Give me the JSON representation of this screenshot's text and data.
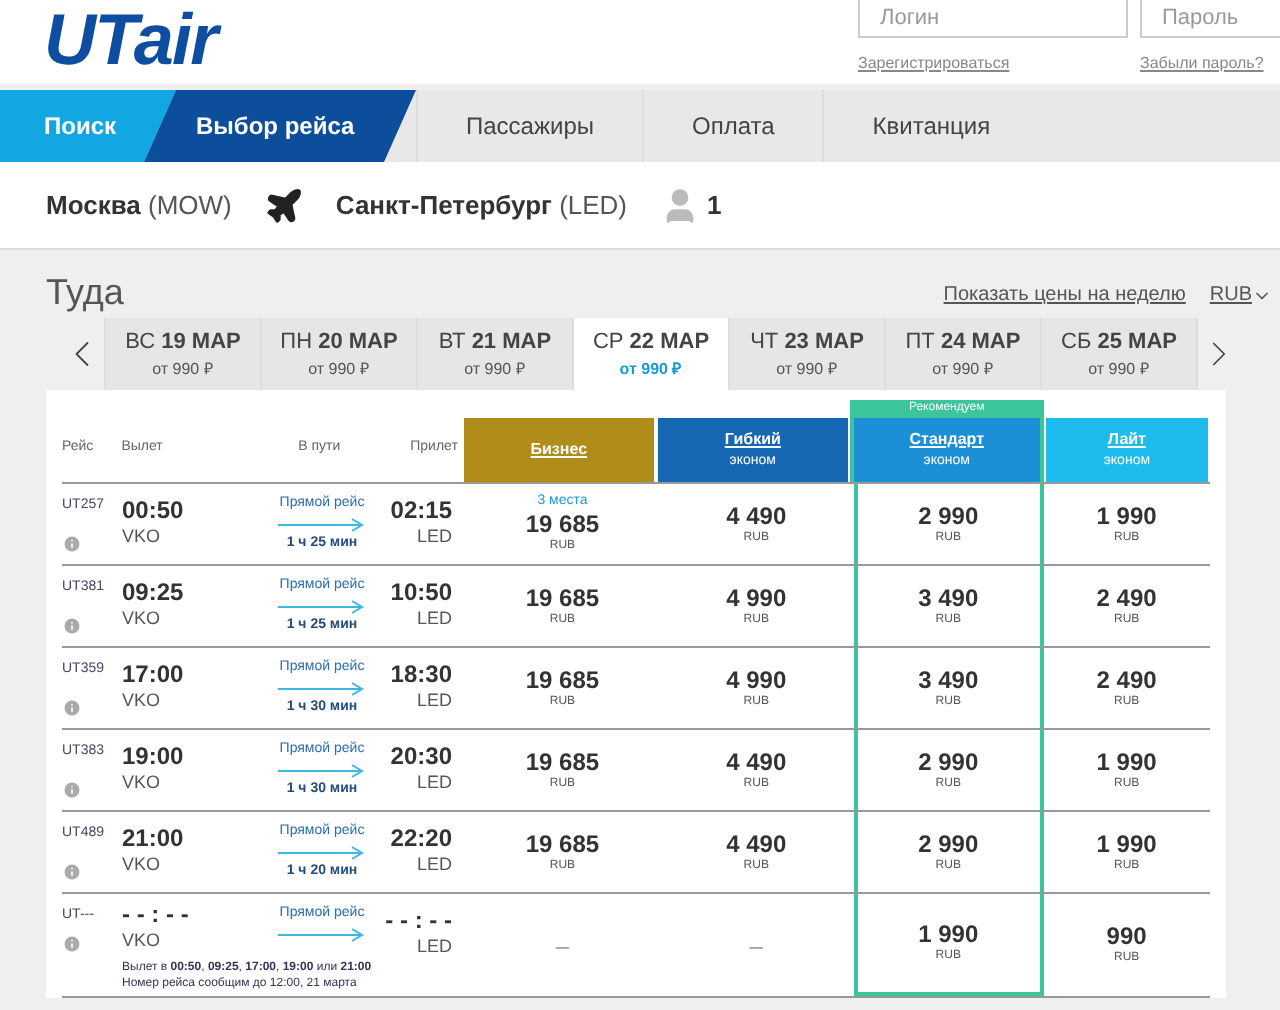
{
  "header": {
    "logo": "UTair",
    "login_placeholder": "Логин",
    "password_placeholder": "Пароль",
    "register_link": "Зарегистрироваться",
    "forgot_link": "Забыли пароль?"
  },
  "steps": [
    {
      "label": "Поиск",
      "completed": true,
      "selected": false
    },
    {
      "label": "Выбор рейса",
      "completed": false,
      "selected": true
    },
    {
      "label": "Пассажиры",
      "completed": false,
      "selected": false
    },
    {
      "label": "Оплата",
      "completed": false,
      "selected": false
    },
    {
      "label": "Квитанция",
      "completed": false,
      "selected": false
    }
  ],
  "route": {
    "from_city": "Москва",
    "from_code": "(MOW)",
    "to_city": "Санкт-Петербург",
    "to_code": "(LED)",
    "passengers": "1"
  },
  "direction": {
    "title": "Туда",
    "week_link": "Показать цены на неделю",
    "currency": "RUB"
  },
  "date_tabs": [
    {
      "weekday": "ВС",
      "date": "19 МАР",
      "price": "от 990 ₽",
      "selected": false
    },
    {
      "weekday": "ПН",
      "date": "20 МАР",
      "price": "от 990 ₽",
      "selected": false
    },
    {
      "weekday": "ВТ",
      "date": "21 МАР",
      "price": "от 990 ₽",
      "selected": false
    },
    {
      "weekday": "СР",
      "date": "22 МАР",
      "price": "от 990 ₽",
      "selected": true
    },
    {
      "weekday": "ЧТ",
      "date": "23 МАР",
      "price": "от 990 ₽",
      "selected": false
    },
    {
      "weekday": "ПТ",
      "date": "24 МАР",
      "price": "от 990 ₽",
      "selected": false
    },
    {
      "weekday": "СБ",
      "date": "25 МАР",
      "price": "от 990 ₽",
      "selected": false
    }
  ],
  "columns": [
    "Рейс",
    "Вылет",
    "В пути",
    "Прилет"
  ],
  "fares": [
    {
      "name": "Бизнес",
      "color": "#b08d1a",
      "recommended": false
    },
    {
      "name": "Гибкий",
      "subtitle": "эконом",
      "color": "#1668b3",
      "recommended": false
    },
    {
      "name": "Стандарт",
      "subtitle": "эконом",
      "color": "#1d8fd6",
      "recommended": true,
      "badge": "Рекомендуем"
    },
    {
      "name": "Лайт",
      "subtitle": "эконом",
      "color": "#1ebcec",
      "recommended": false
    }
  ],
  "flights": [
    {
      "number": "UT257",
      "dep_time": "00:50",
      "dep_airport": "VKO",
      "route_type": "Прямой рейс",
      "duration": "1 ч 25 мин",
      "arr_time": "02:15",
      "arr_airport": "LED",
      "prices": [
        {
          "note": "3 места",
          "amount": "19 685",
          "currency": "RUB"
        },
        {
          "amount": "4 490",
          "currency": "RUB"
        },
        {
          "amount": "2 990",
          "currency": "RUB"
        },
        {
          "amount": "1 990",
          "currency": "RUB"
        }
      ]
    },
    {
      "number": "UT381",
      "dep_time": "09:25",
      "dep_airport": "VKO",
      "route_type": "Прямой рейс",
      "duration": "1 ч 25 мин",
      "arr_time": "10:50",
      "arr_airport": "LED",
      "prices": [
        {
          "amount": "19 685",
          "currency": "RUB"
        },
        {
          "amount": "4 990",
          "currency": "RUB"
        },
        {
          "amount": "3 490",
          "currency": "RUB"
        },
        {
          "amount": "2 490",
          "currency": "RUB"
        }
      ]
    },
    {
      "number": "UT359",
      "dep_time": "17:00",
      "dep_airport": "VKO",
      "route_type": "Прямой рейс",
      "duration": "1 ч 30 мин",
      "arr_time": "18:30",
      "arr_airport": "LED",
      "prices": [
        {
          "amount": "19 685",
          "currency": "RUB"
        },
        {
          "amount": "4 990",
          "currency": "RUB"
        },
        {
          "amount": "3 490",
          "currency": "RUB"
        },
        {
          "amount": "2 490",
          "currency": "RUB"
        }
      ]
    },
    {
      "number": "UT383",
      "dep_time": "19:00",
      "dep_airport": "VKO",
      "route_type": "Прямой рейс",
      "duration": "1 ч 30 мин",
      "arr_time": "20:30",
      "arr_airport": "LED",
      "prices": [
        {
          "amount": "19 685",
          "currency": "RUB"
        },
        {
          "amount": "4 490",
          "currency": "RUB"
        },
        {
          "amount": "2 990",
          "currency": "RUB"
        },
        {
          "amount": "1 990",
          "currency": "RUB"
        }
      ]
    },
    {
      "number": "UT489",
      "dep_time": "21:00",
      "dep_airport": "VKO",
      "route_type": "Прямой рейс",
      "duration": "1 ч 20 мин",
      "arr_time": "22:20",
      "arr_airport": "LED",
      "prices": [
        {
          "amount": "19 685",
          "currency": "RUB"
        },
        {
          "amount": "4 490",
          "currency": "RUB"
        },
        {
          "amount": "2 990",
          "currency": "RUB"
        },
        {
          "amount": "1 990",
          "currency": "RUB"
        }
      ]
    },
    {
      "number": "UT---",
      "dep_time": "- - : - -",
      "dep_airport": "VKO",
      "route_type": "Прямой рейс",
      "arr_time": "- - : - -",
      "arr_airport": "LED",
      "note": "Вылет в **00:50**, **09:25**, **17:00**, **19:00** или **21:00**\nНомер рейса сообщим до 12:00, 21 марта",
      "prices": [
        {
          "amount": "–"
        },
        {
          "amount": "–"
        },
        {
          "amount": "1 990",
          "currency": "RUB"
        },
        {
          "amount": "990",
          "currency": "RUB"
        }
      ]
    }
  ]
}
